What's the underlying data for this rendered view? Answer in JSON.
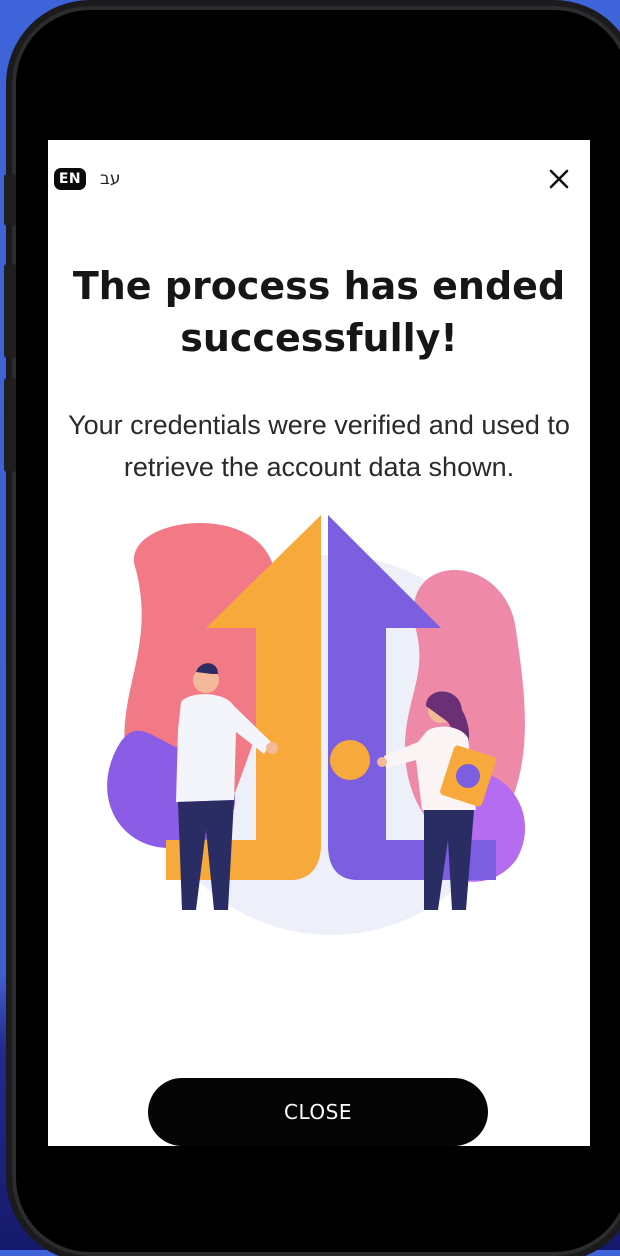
{
  "header": {
    "lang_active": "EN",
    "lang_alt": "עב",
    "close_icon": "close-icon"
  },
  "main": {
    "title": "The process has ended successfully!",
    "description": "Your credentials were verified and used to retrieve the account data shown.",
    "illustration": "two-people-connecting-arrows-illustration"
  },
  "footer": {
    "close_label": "CLOSE"
  },
  "colors": {
    "primary_button": "#050505",
    "arrow_orange": "#f7a93b",
    "arrow_purple": "#7b5fe0",
    "blob_pink": "#f27a86"
  }
}
